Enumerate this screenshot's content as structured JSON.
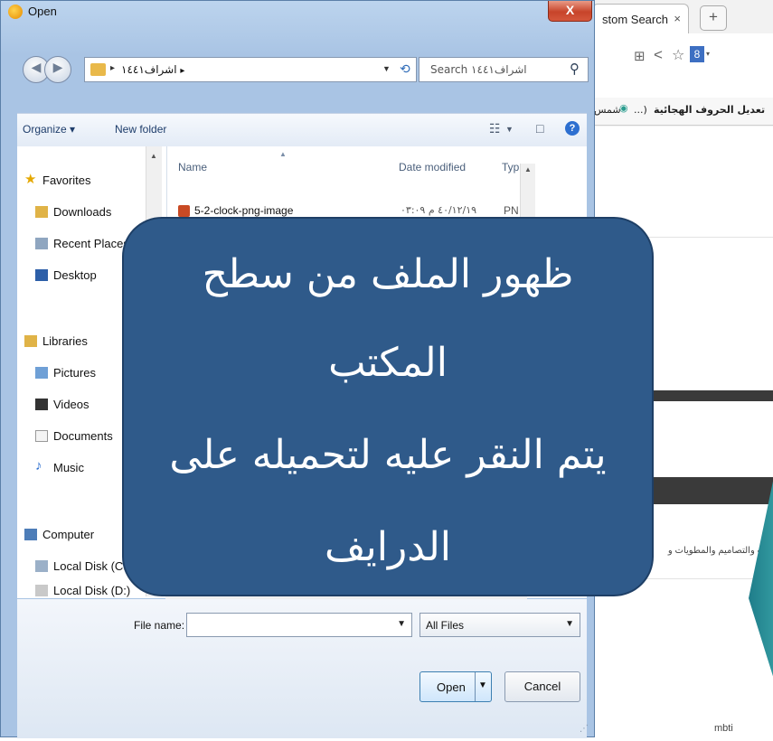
{
  "browser": {
    "tab_label": "stom Search",
    "tab_close": "×",
    "new_tab": "+",
    "bookmark_1": "تعديل الحروف الهجائية",
    "bookmark_2": "...)",
    "bookmark_3": "شمس",
    "page_footer_text": "mbti",
    "page_snippet": "ونت والتصاميم والمطويات و"
  },
  "dialog": {
    "title": "Open",
    "close_label": "X",
    "address": {
      "separator": "▸",
      "path": "اشراف١٤٤١",
      "path_sep": "▸"
    },
    "search_placeholder": "Search اشراف١٤٤١",
    "toolbar": {
      "organize": "Organize ▾",
      "new_folder": "New folder"
    },
    "nav": {
      "favorites": "Favorites",
      "downloads": "Downloads",
      "recent_places": "Recent Places",
      "desktop": "Desktop",
      "libraries": "Libraries",
      "pictures": "Pictures",
      "videos": "Videos",
      "documents": "Documents",
      "music": "Music",
      "computer": "Computer",
      "local_c": "Local Disk (C:)",
      "local_d": "Local Disk (D:)"
    },
    "columns": {
      "name": "Name",
      "date_modified": "Date modified",
      "type": "Typ"
    },
    "files": [
      {
        "name": "5-2-clock-png-image",
        "date": "٤٠/١٢/١٩ م ٠٣:٠٩",
        "type": "PN"
      }
    ],
    "file_name_label": "File name:",
    "file_name_value": "",
    "filter": "All Files",
    "open_label": "Open",
    "cancel_label": "Cancel"
  },
  "callout": {
    "line1": "ظهور  الملف من سطح",
    "line2": "المكتب",
    "line3": "يتم النقر عليه لتحميله على",
    "line4": "الدرايف"
  },
  "colors": {
    "callout_bg": "#2f5a8a",
    "dialog_frame": "#a9c4e4",
    "close_red": "#c7442a"
  }
}
